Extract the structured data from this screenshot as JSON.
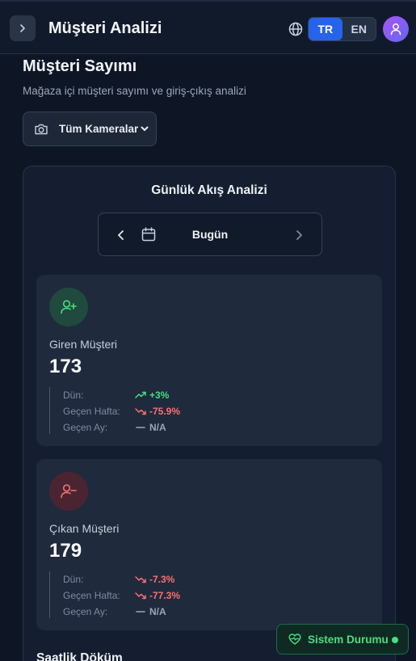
{
  "header": {
    "title": "Müşteri Analizi",
    "languages": [
      {
        "code": "TR",
        "active": true
      },
      {
        "code": "EN",
        "active": false
      }
    ]
  },
  "page": {
    "title": "Müşteri Sayımı",
    "subtitle": "Mağaza içi müşteri sayımı ve giriş-çıkış analizi"
  },
  "camera_filter": {
    "selected": "Tüm Kameralar"
  },
  "flow_panel": {
    "title": "Günlük Akış Analizi",
    "date_label": "Bugün",
    "cards": [
      {
        "label": "Giren Müşteri",
        "value": "173",
        "accent": "#4ade80",
        "comparisons": [
          {
            "label": "Dün:",
            "value": "+3%",
            "trend": "up"
          },
          {
            "label": "Geçen Hafta:",
            "value": "-75.9%",
            "trend": "down"
          },
          {
            "label": "Geçen Ay:",
            "value": "N/A",
            "trend": "flat"
          }
        ]
      },
      {
        "label": "Çıkan Müşteri",
        "value": "179",
        "accent": "#f87171",
        "comparisons": [
          {
            "label": "Dün:",
            "value": "-7.3%",
            "trend": "down"
          },
          {
            "label": "Geçen Hafta:",
            "value": "-77.3%",
            "trend": "down"
          },
          {
            "label": "Geçen Ay:",
            "value": "N/A",
            "trend": "flat"
          }
        ]
      }
    ]
  },
  "hourly": {
    "title": "Saatlik Döküm"
  },
  "system_status": {
    "label": "Sistem Durumu",
    "status_color": "#4ade80"
  },
  "icons": {
    "sidebar_toggle": "chevron-right-icon",
    "language": "globe-icon",
    "avatar": "user-icon",
    "camera": "camera-icon",
    "prev_date": "chevron-left-icon",
    "calendar": "calendar-icon",
    "next_date": "chevron-right-icon",
    "entered": "user-plus-icon",
    "exited": "user-minus-icon",
    "status": "heart-pulse-icon"
  }
}
